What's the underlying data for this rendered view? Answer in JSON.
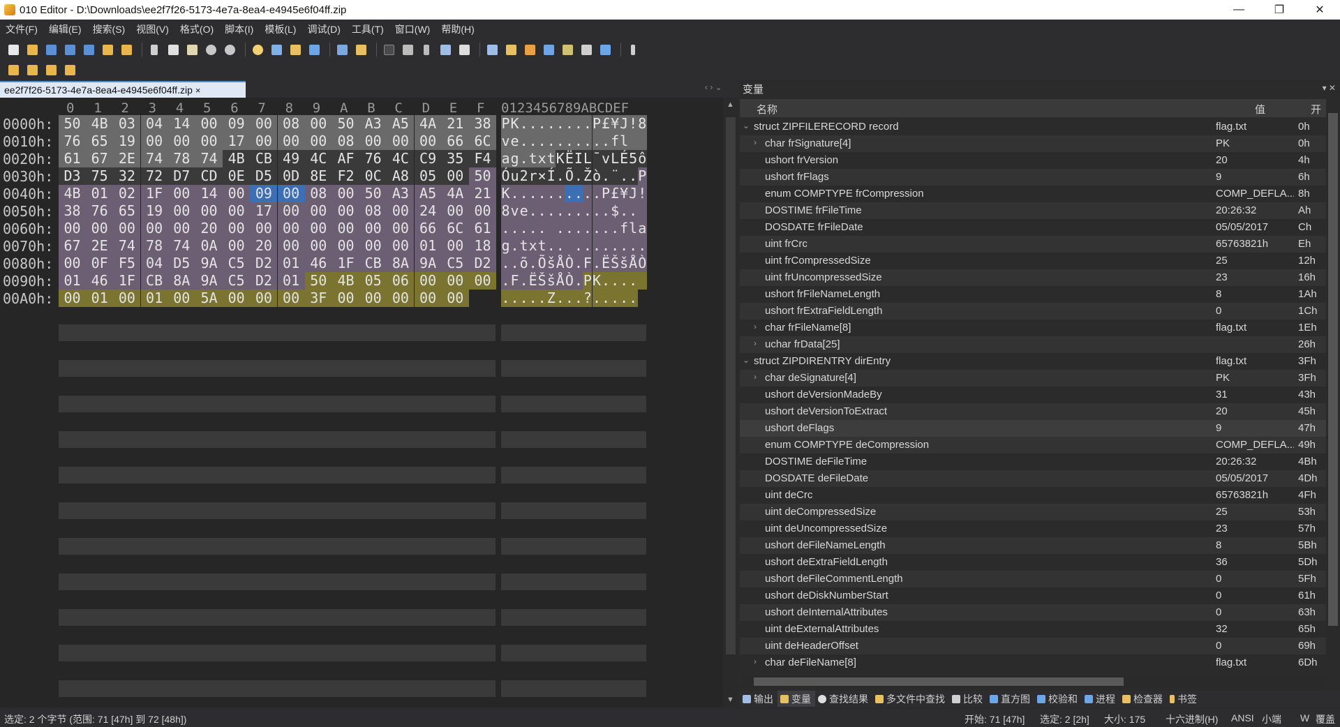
{
  "window": {
    "title": "010 Editor - D:\\Downloads\\ee2f7f26-5173-4e7a-8ea4-e4945e6f04ff.zip",
    "minimize": "—",
    "restore": "❐",
    "close": "✕"
  },
  "menu": [
    "文件(F)",
    "编辑(E)",
    "搜索(S)",
    "视图(V)",
    "格式(O)",
    "脚本(I)",
    "模板(L)",
    "调试(D)",
    "工具(T)",
    "窗口(W)",
    "帮助(H)"
  ],
  "tab": {
    "filename": "ee2f7f26-5173-4e7a-8ea4-e4945e6f04ff.zip",
    "close": "×"
  },
  "hex": {
    "col_headers": [
      "0",
      "1",
      "2",
      "3",
      "4",
      "5",
      "6",
      "7",
      "8",
      "9",
      "A",
      "B",
      "C",
      "D",
      "E",
      "F"
    ],
    "ascii_header": "0123456789ABCDEF",
    "rows": [
      {
        "addr": "0000h:",
        "bytes": [
          "50",
          "4B",
          "03",
          "04",
          "14",
          "00",
          "09",
          "00",
          "08",
          "00",
          "50",
          "A3",
          "A5",
          "4A",
          "21",
          "38"
        ],
        "ascii": "PK........P£¥J!8"
      },
      {
        "addr": "0010h:",
        "bytes": [
          "76",
          "65",
          "19",
          "00",
          "00",
          "00",
          "17",
          "00",
          "00",
          "00",
          "08",
          "00",
          "00",
          "00",
          "66",
          "6C"
        ],
        "ascii": "ve..........fl"
      },
      {
        "addr": "0020h:",
        "bytes": [
          "61",
          "67",
          "2E",
          "74",
          "78",
          "74",
          "4B",
          "CB",
          "49",
          "4C",
          "AF",
          "76",
          "4C",
          "C9",
          "35",
          "F4"
        ],
        "ascii": "ag.txtKËIL¯vLÉ5ô"
      },
      {
        "addr": "0030h:",
        "bytes": [
          "D3",
          "75",
          "32",
          "72",
          "D7",
          "CD",
          "0E",
          "D5",
          "0D",
          "8E",
          "F2",
          "0C",
          "A8",
          "05",
          "00",
          "50"
        ],
        "ascii": "Óu2r×Í.Õ.Žò.¨..P"
      },
      {
        "addr": "0040h:",
        "bytes": [
          "4B",
          "01",
          "02",
          "1F",
          "00",
          "14",
          "00",
          "09",
          "00",
          "08",
          "00",
          "50",
          "A3",
          "A5",
          "4A",
          "21"
        ],
        "ascii": "K..........P£¥J!"
      },
      {
        "addr": "0050h:",
        "bytes": [
          "38",
          "76",
          "65",
          "19",
          "00",
          "00",
          "00",
          "17",
          "00",
          "00",
          "00",
          "08",
          "00",
          "24",
          "00",
          "00"
        ],
        "ascii": "8ve.........$.."
      },
      {
        "addr": "0060h:",
        "bytes": [
          "00",
          "00",
          "00",
          "00",
          "00",
          "20",
          "00",
          "00",
          "00",
          "00",
          "00",
          "00",
          "00",
          "66",
          "6C",
          "61"
        ],
        "ascii": "..... .......fla"
      },
      {
        "addr": "0070h:",
        "bytes": [
          "67",
          "2E",
          "74",
          "78",
          "74",
          "0A",
          "00",
          "20",
          "00",
          "00",
          "00",
          "00",
          "00",
          "01",
          "00",
          "18"
        ],
        "ascii": "g.txt.. ........"
      },
      {
        "addr": "0080h:",
        "bytes": [
          "00",
          "0F",
          "F5",
          "04",
          "D5",
          "9A",
          "C5",
          "D2",
          "01",
          "46",
          "1F",
          "CB",
          "8A",
          "9A",
          "C5",
          "D2"
        ],
        "ascii": "..õ.ÕšÅÒ.F.ËŠšÅÒ"
      },
      {
        "addr": "0090h:",
        "bytes": [
          "01",
          "46",
          "1F",
          "CB",
          "8A",
          "9A",
          "C5",
          "D2",
          "01",
          "50",
          "4B",
          "05",
          "06",
          "00",
          "00",
          "00"
        ],
        "ascii": ".F.ËŠšÅÒ.PK...."
      },
      {
        "addr": "00A0h:",
        "bytes": [
          "00",
          "01",
          "00",
          "01",
          "00",
          "5A",
          "00",
          "00",
          "00",
          "3F",
          "00",
          "00",
          "00",
          "00",
          "00"
        ],
        "ascii": ".....Z...?....."
      }
    ]
  },
  "variables": {
    "title": "变量",
    "columns": {
      "name": "名称",
      "value": "值",
      "offset": "开"
    },
    "rows": [
      {
        "name": "struct ZIPFILERECORD record",
        "value": "flag.txt",
        "offset": "0h",
        "level": 0,
        "expander": "⌄"
      },
      {
        "name": "char frSignature[4]",
        "value": "PK",
        "offset": "0h",
        "level": 1,
        "expander": "›"
      },
      {
        "name": "ushort frVersion",
        "value": "20",
        "offset": "4h",
        "level": 1,
        "expander": ""
      },
      {
        "name": "ushort frFlags",
        "value": "9",
        "offset": "6h",
        "level": 1,
        "expander": ""
      },
      {
        "name": "enum COMPTYPE frCompression",
        "value": "COMP_DEFLA...",
        "offset": "8h",
        "level": 1,
        "expander": ""
      },
      {
        "name": "DOSTIME frFileTime",
        "value": "20:26:32",
        "offset": "Ah",
        "level": 1,
        "expander": ""
      },
      {
        "name": "DOSDATE frFileDate",
        "value": "05/05/2017",
        "offset": "Ch",
        "level": 1,
        "expander": ""
      },
      {
        "name": "uint frCrc",
        "value": "65763821h",
        "offset": "Eh",
        "level": 1,
        "expander": ""
      },
      {
        "name": "uint frCompressedSize",
        "value": "25",
        "offset": "12h",
        "level": 1,
        "expander": ""
      },
      {
        "name": "uint frUncompressedSize",
        "value": "23",
        "offset": "16h",
        "level": 1,
        "expander": ""
      },
      {
        "name": "ushort frFileNameLength",
        "value": "8",
        "offset": "1Ah",
        "level": 1,
        "expander": ""
      },
      {
        "name": "ushort frExtraFieldLength",
        "value": "0",
        "offset": "1Ch",
        "level": 1,
        "expander": ""
      },
      {
        "name": "char frFileName[8]",
        "value": "flag.txt",
        "offset": "1Eh",
        "level": 1,
        "expander": "›"
      },
      {
        "name": "uchar frData[25]",
        "value": "",
        "offset": "26h",
        "level": 1,
        "expander": "›"
      },
      {
        "name": "struct ZIPDIRENTRY dirEntry",
        "value": "flag.txt",
        "offset": "3Fh",
        "level": 0,
        "expander": "⌄"
      },
      {
        "name": "char deSignature[4]",
        "value": "PK",
        "offset": "3Fh",
        "level": 1,
        "expander": "›"
      },
      {
        "name": "ushort deVersionMadeBy",
        "value": "31",
        "offset": "43h",
        "level": 1,
        "expander": ""
      },
      {
        "name": "ushort deVersionToExtract",
        "value": "20",
        "offset": "45h",
        "level": 1,
        "expander": ""
      },
      {
        "name": "ushort deFlags",
        "value": "9",
        "offset": "47h",
        "level": 1,
        "expander": ""
      },
      {
        "name": "enum COMPTYPE deCompression",
        "value": "COMP_DEFLA...",
        "offset": "49h",
        "level": 1,
        "expander": ""
      },
      {
        "name": "DOSTIME deFileTime",
        "value": "20:26:32",
        "offset": "4Bh",
        "level": 1,
        "expander": ""
      },
      {
        "name": "DOSDATE deFileDate",
        "value": "05/05/2017",
        "offset": "4Dh",
        "level": 1,
        "expander": ""
      },
      {
        "name": "uint deCrc",
        "value": "65763821h",
        "offset": "4Fh",
        "level": 1,
        "expander": ""
      },
      {
        "name": "uint deCompressedSize",
        "value": "25",
        "offset": "53h",
        "level": 1,
        "expander": ""
      },
      {
        "name": "uint deUncompressedSize",
        "value": "23",
        "offset": "57h",
        "level": 1,
        "expander": ""
      },
      {
        "name": "ushort deFileNameLength",
        "value": "8",
        "offset": "5Bh",
        "level": 1,
        "expander": ""
      },
      {
        "name": "ushort deExtraFieldLength",
        "value": "36",
        "offset": "5Dh",
        "level": 1,
        "expander": ""
      },
      {
        "name": "ushort deFileCommentLength",
        "value": "0",
        "offset": "5Fh",
        "level": 1,
        "expander": ""
      },
      {
        "name": "ushort deDiskNumberStart",
        "value": "0",
        "offset": "61h",
        "level": 1,
        "expander": ""
      },
      {
        "name": "ushort deInternalAttributes",
        "value": "0",
        "offset": "63h",
        "level": 1,
        "expander": ""
      },
      {
        "name": "uint deExternalAttributes",
        "value": "32",
        "offset": "65h",
        "level": 1,
        "expander": ""
      },
      {
        "name": "uint deHeaderOffset",
        "value": "0",
        "offset": "69h",
        "level": 1,
        "expander": ""
      },
      {
        "name": "char deFileName[8]",
        "value": "flag.txt",
        "offset": "6Dh",
        "level": 1,
        "expander": "›"
      }
    ]
  },
  "bottom_tabs": [
    "输出",
    "变量",
    "查找结果",
    "多文件中查找",
    "比较",
    "直方图",
    "校验和",
    "进程",
    "检查器",
    "书签"
  ],
  "status": {
    "selection": "选定: 2 个字节 (范围: 71 [47h] 到 72 [48h])",
    "start": "开始: 71 [47h]",
    "selected": "选定: 2 [2h]",
    "size": "大小: 175",
    "mode": "十六进制(H)",
    "encoding": "ANSI",
    "endian": "小端",
    "w": "W",
    "overwrite": "覆盖"
  },
  "colors": {
    "gray_field": "#6a6a6a",
    "mauve_field": "#6d5f73",
    "olive_field": "#7a7430",
    "selection": "#3d6fb5"
  }
}
